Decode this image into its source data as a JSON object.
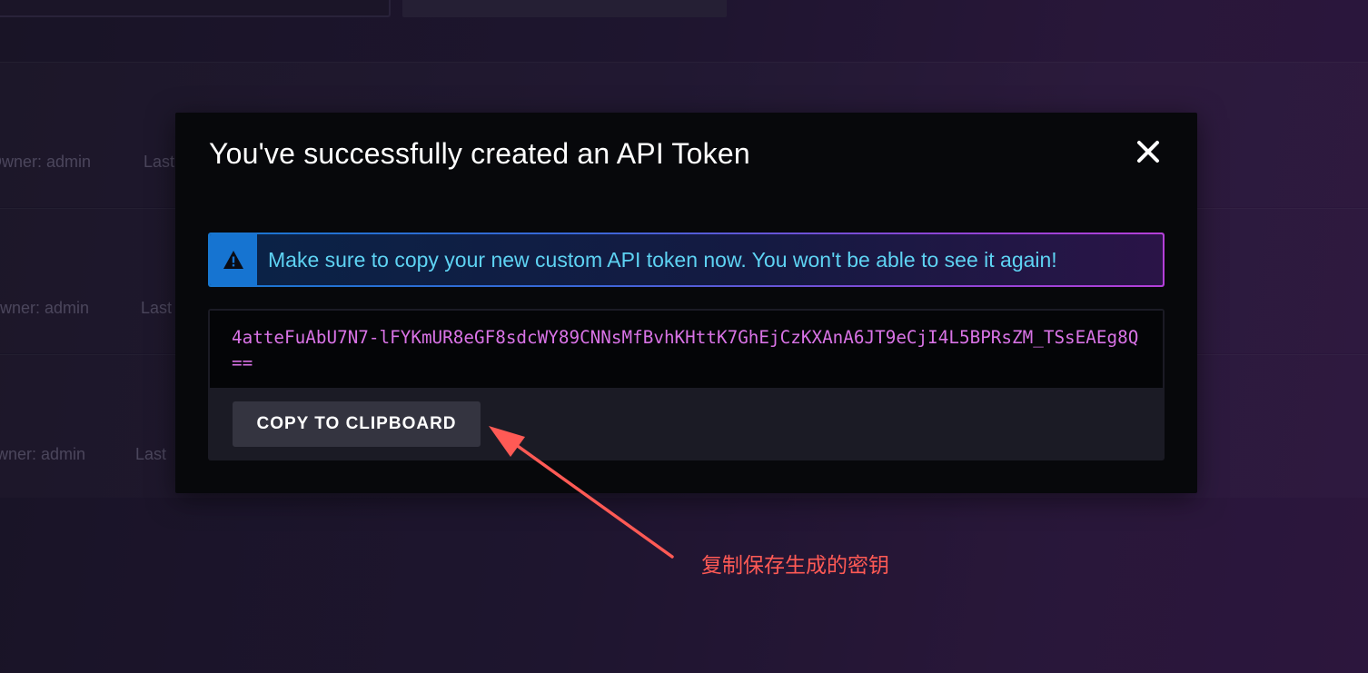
{
  "background": {
    "rows": [
      {
        "owner": "Owner: admin",
        "last": "Last"
      },
      {
        "owner": "Owner: admin",
        "last": "Last"
      },
      {
        "owner": "Owner: admin",
        "last": "Last"
      }
    ]
  },
  "modal": {
    "title": "You've successfully created an API Token",
    "close_icon": "close-icon",
    "alert": {
      "icon": "warning-icon",
      "text": "Make sure to copy your new custom API token now. You won't be able to see it again!"
    },
    "token": "4atteFuAbU7N7-lFYKmUR8eGF8sdcWY89CNNsMfBvhKHttK7GhEjCzKXAnA6JT9eCjI4L5BPRsZM_TSsEAEg8Q==",
    "copy_button_label": "COPY TO CLIPBOARD"
  },
  "annotation": {
    "text": "复制保存生成的密钥",
    "color": "#ff5a55"
  },
  "colors": {
    "modal_bg": "#07080b",
    "token_text": "#d973e6",
    "alert_text": "#5ed3f3",
    "alert_icon_bg": "#1674d1"
  }
}
